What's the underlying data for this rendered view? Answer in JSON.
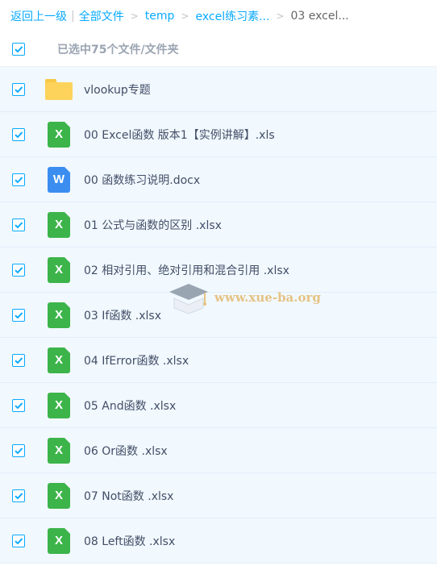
{
  "breadcrumb": {
    "back": "返回上一级",
    "all_files": "全部文件",
    "sep": ">",
    "crumbs": [
      "temp",
      "excel练习素..."
    ],
    "current": "03 excel..."
  },
  "selection": {
    "label": "已选中75个文件/文件夹",
    "checked": true
  },
  "files": [
    {
      "name": "vlookup专题",
      "type": "folder"
    },
    {
      "name": "00 Excel函数 版本1【实例讲解】.xls",
      "type": "xls",
      "icon_letter": "X"
    },
    {
      "name": "00 函数练习说明.docx",
      "type": "doc",
      "icon_letter": "W"
    },
    {
      "name": "01 公式与函数的区别 .xlsx",
      "type": "xls",
      "icon_letter": "X"
    },
    {
      "name": "02 相对引用、绝对引用和混合引用 .xlsx",
      "type": "xls",
      "icon_letter": "X"
    },
    {
      "name": "03 If函数 .xlsx",
      "type": "xls",
      "icon_letter": "X"
    },
    {
      "name": "04 IfError函数 .xlsx",
      "type": "xls",
      "icon_letter": "X"
    },
    {
      "name": "05 And函数 .xlsx",
      "type": "xls",
      "icon_letter": "X"
    },
    {
      "name": "06 Or函数 .xlsx",
      "type": "xls",
      "icon_letter": "X"
    },
    {
      "name": "07 Not函数 .xlsx",
      "type": "xls",
      "icon_letter": "X"
    },
    {
      "name": "08 Left函数 .xlsx",
      "type": "xls",
      "icon_letter": "X"
    }
  ],
  "watermark": "www.xue-ba.org",
  "colors": {
    "accent": "#09aaff",
    "excel": "#3cb44a",
    "word": "#3b8ef0",
    "folder": "#fdd35b",
    "row_bg": "#f1f8fe"
  }
}
